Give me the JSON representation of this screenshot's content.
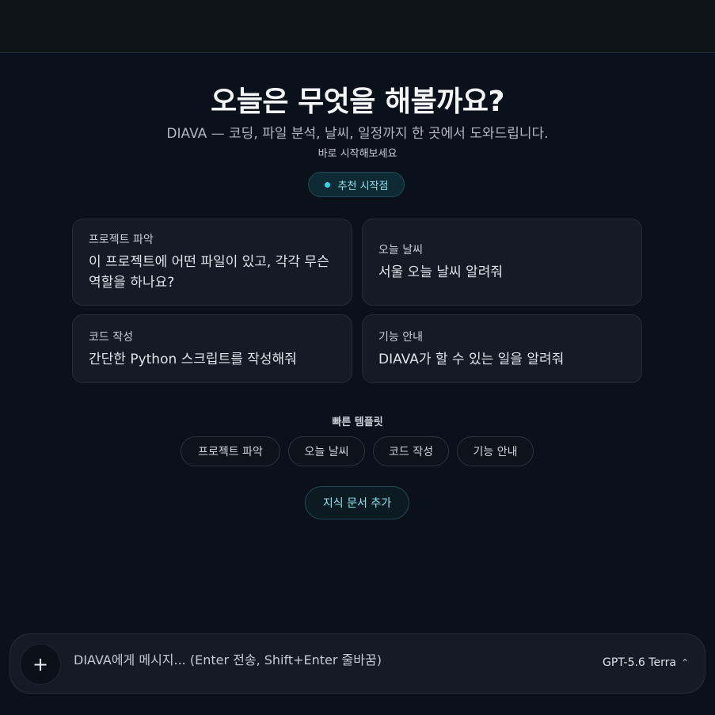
{
  "main": {
    "heading": "오늘은 무엇을 해볼까요?",
    "subtitle": "DIAVA — 코딩, 파일 분석, 날씨, 일정까지 한 곳에서 도와드립니다.",
    "hint": "바로 시작해보세요",
    "badge": "추천 시작점"
  },
  "cards": [
    {
      "title": "프로젝트 파악",
      "body": "이 프로젝트에 어떤 파일이 있고, 각각 무슨 역할을 하나요?"
    },
    {
      "title": "오늘 날씨",
      "body": "서울 오늘 날씨 알려줘"
    },
    {
      "title": "코드 작성",
      "body": "간단한 Python 스크립트를 작성해줘"
    },
    {
      "title": "기능 안내",
      "body": "DIAVA가 할 수 있는 일을 알려줘"
    }
  ],
  "quick_templates": {
    "label": "빠른 템플릿",
    "chips": [
      "프로젝트 파악",
      "오늘 날씨",
      "코드 작성",
      "기능 안내"
    ]
  },
  "knowledge_button": "지식 문서 추가",
  "composer": {
    "placeholder": "DIAVA에게 메시지... (Enter 전송, Shift+Enter 줄바꿈)",
    "model": "GPT-5.6 Terra",
    "plus_icon": "plus-icon",
    "chevron_icon": "chevron-up-icon"
  },
  "colors": {
    "accent": "#3fd0e6",
    "background": "#0b111a",
    "card": "#141b24"
  }
}
